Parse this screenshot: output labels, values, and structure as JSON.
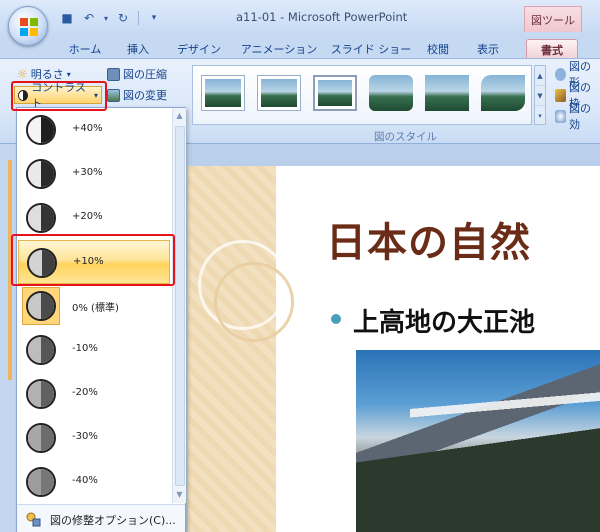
{
  "window": {
    "title": "a11-01 - Microsoft PowerPoint",
    "context_tab_title": "図ツール"
  },
  "tabs": [
    {
      "label": "ホーム"
    },
    {
      "label": "挿入"
    },
    {
      "label": "デザイン"
    },
    {
      "label": "アニメーション"
    },
    {
      "label": "スライド ショー"
    },
    {
      "label": "校閲"
    },
    {
      "label": "表示"
    },
    {
      "label": "書式",
      "active": true
    }
  ],
  "ribbon": {
    "brightness_label": "明るさ",
    "contrast_label": "コントラスト",
    "compress_label": "図の圧縮",
    "change_label": "図の変更",
    "styles_group_label": "図のスタイル",
    "right_buttons": [
      "図の形",
      "図の枠",
      "図の効"
    ]
  },
  "contrast_menu": {
    "items": [
      {
        "label": "+40%",
        "level": 0.9
      },
      {
        "label": "+30%",
        "level": 0.8
      },
      {
        "label": "+20%",
        "level": 0.7
      },
      {
        "label": "+10%",
        "level": 0.6,
        "highlighted": true
      },
      {
        "label": "0% (標準)",
        "level": 0.5,
        "current": true
      },
      {
        "label": "-10%",
        "level": 0.4
      },
      {
        "label": "-20%",
        "level": 0.3
      },
      {
        "label": "-30%",
        "level": 0.2
      },
      {
        "label": "-40%",
        "level": 0.1
      }
    ],
    "footer_label": "図の修整オプション(C)..."
  },
  "slide": {
    "title": "日本の自然",
    "bullet": "上高地の大正池"
  },
  "colors": {
    "highlight_box": "#e8121b",
    "slide_title": "#6a2c16",
    "bullet_dot": "#4a9fb9",
    "context_tab": "#efc7cf"
  }
}
